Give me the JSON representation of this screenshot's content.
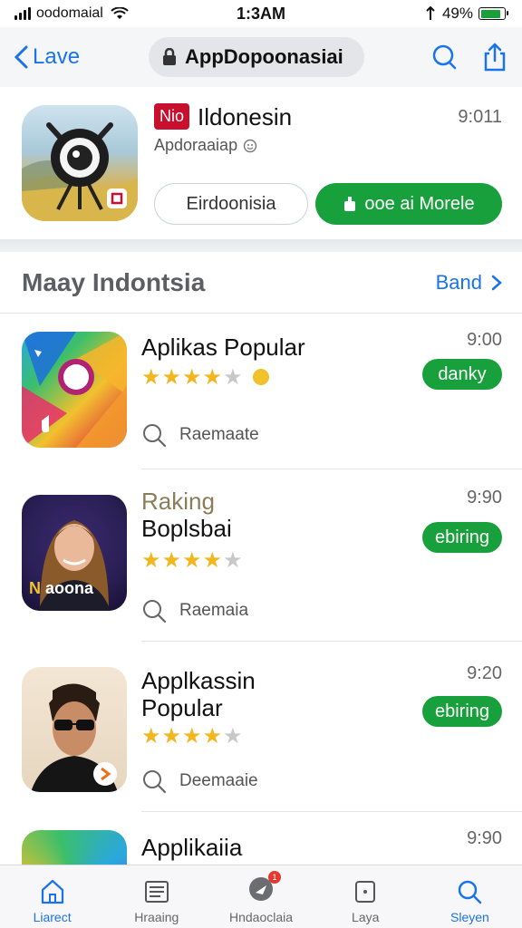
{
  "status_bar": {
    "carrier": "oodomaial",
    "time": "1:3AM",
    "battery_percent": "49%",
    "battery_level": 0.85
  },
  "nav": {
    "back_label": "Lave",
    "title": "AppDopoonasiai"
  },
  "featured": {
    "badge": "Nio",
    "title": "Ildonesin",
    "subtitle": "Apdoraaiap",
    "time": "9:011",
    "outline_button": "Eirdoonisia",
    "green_button": "ooe ai Morele"
  },
  "section": {
    "title": "Maay Indontsia",
    "see_all": "Band"
  },
  "apps": [
    {
      "name_line1": "Aplikas Popular",
      "name_line2": "",
      "time": "9:00",
      "rating": 4.5,
      "button": "danky",
      "hint": "Raemaate"
    },
    {
      "name_line1": "Raking",
      "name_line2": "Boplsbai",
      "time": "9:90",
      "rating": 4,
      "button": "ebiring",
      "hint": "Raemaia"
    },
    {
      "name_line1": "Applkassin",
      "name_line2": "Popular",
      "time": "9:20",
      "rating": 4,
      "button": "ebiring",
      "hint": "Deemaaie"
    },
    {
      "name_line1": "Applikaiia",
      "name_line2": "",
      "time": "9:90"
    }
  ],
  "icon_text": {
    "app2_brand": "aoona"
  },
  "tabs": [
    {
      "label": "Liarect",
      "icon": "home-icon"
    },
    {
      "label": "Hraaing",
      "icon": "list-icon"
    },
    {
      "label": "Hndaoclaia",
      "icon": "games-icon",
      "badge": "1"
    },
    {
      "label": "Laya",
      "icon": "square-icon"
    },
    {
      "label": "Sleyen",
      "icon": "search-icon"
    }
  ],
  "colors": {
    "accent": "#1a73e8",
    "green": "#18a03c",
    "star": "#f2b61f"
  }
}
